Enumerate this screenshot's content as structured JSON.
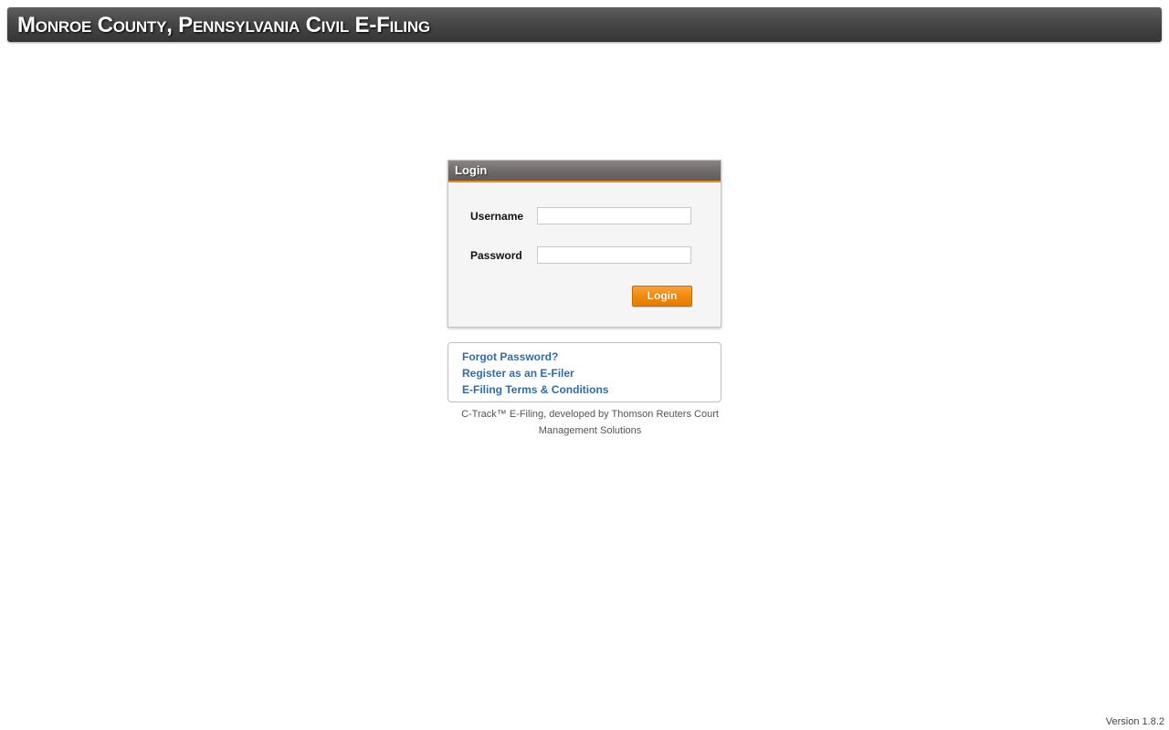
{
  "header": {
    "title": "Monroe County, Pennsylvania Civil E-Filing"
  },
  "login_panel": {
    "title": "Login",
    "username_label": "Username",
    "username_value": "",
    "password_label": "Password",
    "password_value": "",
    "login_button_label": "Login"
  },
  "links": {
    "forgot_password": "Forgot Password?",
    "register": "Register as an E-Filer",
    "terms": "E-Filing Terms & Conditions"
  },
  "footer": {
    "credit_line1": "C-Track™ E-Filing, developed by Thomson Reuters Court",
    "credit_line2": "Management Solutions",
    "version": "Version 1.8.2"
  },
  "colors": {
    "header_bar": "#474747",
    "panel_header": "#6f6a6a",
    "accent_orange": "#f18a0c",
    "link_blue": "#2f6ea5"
  }
}
